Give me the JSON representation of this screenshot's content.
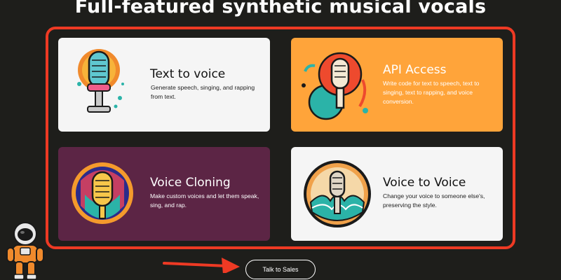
{
  "headline": "Full-featured synthetic musical vocals",
  "features": [
    {
      "title": "Text to voice",
      "description": "Generate speech, singing, and rapping from text.",
      "icon": "microphone-icon"
    },
    {
      "title": "API Access",
      "description": "Write code for text to speech, text to singing, text to rapping, and voice conversion.",
      "icon": "microphone-icon"
    },
    {
      "title": "Voice Cloning",
      "description": "Make custom voices and let them speak, sing, and rap.",
      "icon": "microphone-icon"
    },
    {
      "title": "Voice to Voice",
      "description": "Change your voice to someone else's, preserving the style.",
      "icon": "microphone-icon"
    }
  ],
  "cta_label": "Talk to Sales",
  "colors": {
    "background": "#1e1e1b",
    "highlight": "#ee3a24",
    "api_card": "#ffa43a",
    "cloning_card": "#5c2545",
    "light_card": "#f5f5f5"
  }
}
